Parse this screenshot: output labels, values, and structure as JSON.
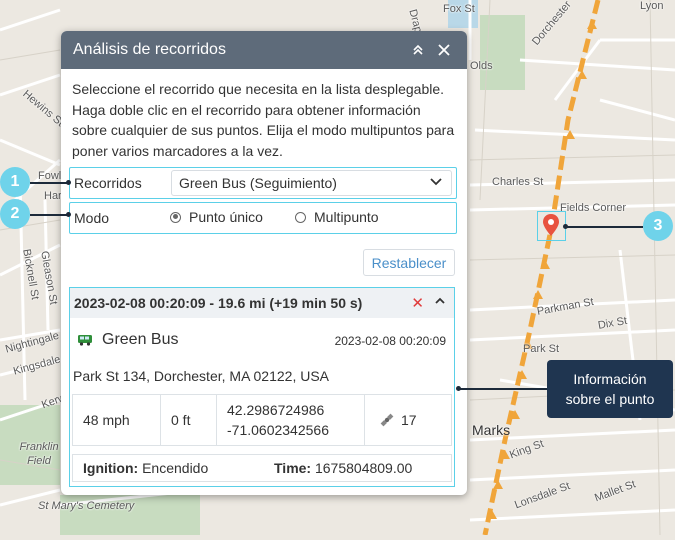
{
  "map": {
    "streets": [
      "Fox St",
      "Lyon",
      "Drape",
      "Hewins St",
      "Fowle",
      "Harl",
      "Charles St",
      "Fields Corner",
      "Bicknell St",
      "Gleason St",
      "Nightingale St",
      "Kingsdale St",
      "Kerw",
      "Parkman St",
      "Dix St",
      "Park St",
      "Marks",
      "King St",
      "Lonsdale St",
      "Mallet St",
      "Franklin Field",
      "St Mary's Cemetery",
      "Dorchester",
      "Olds"
    ],
    "route_color": "#f0a53a",
    "water_color": "#b9d8e8",
    "park_color": "#c8dcc0"
  },
  "panel": {
    "title": "Análisis de recorridos",
    "collapse_icon": "double-chevron-up-icon",
    "close_icon": "close-icon",
    "description": "Seleccione el recorrido que necesita en la lista desplegable. Haga doble clic en el recorrido para obtener información sobre cualquier de sus puntos. Elija el modo multipuntos para poner varios marcadores a la vez.",
    "route_label": "Recorridos",
    "route_value": "Green Bus (Seguimiento)",
    "mode_label": "Modo",
    "mode_options": [
      "Punto único",
      "Multipunto"
    ],
    "mode_selected": "Punto único",
    "reset_label": "Restablecer",
    "card": {
      "header": "2023-02-08 00:20:09 - 19.6 mi (+19 min 50 s)",
      "unit_name": "Green Bus",
      "unit_time": "2023-02-08 00:20:09",
      "address": "Park St 134, Dorchester, MA 02122, USA",
      "speed": "48 mph",
      "altitude": "0 ft",
      "lat": "42.2986724986",
      "lon": "-71.0602342566",
      "satellites": "17",
      "ignition_label": "Ignition:",
      "ignition_value": "Encendido",
      "time_label": "Time:",
      "time_value": "1675804809.00"
    }
  },
  "badges": [
    "1",
    "2",
    "3"
  ],
  "tooltip": [
    "Información",
    "sobre el punto"
  ],
  "colors": {
    "accent": "#5bd0e8",
    "header": "#5e6b7a",
    "tooltip": "#1f3550",
    "link": "#4a8fc9",
    "close": "#e03b3b",
    "marker": "#e8523f"
  }
}
